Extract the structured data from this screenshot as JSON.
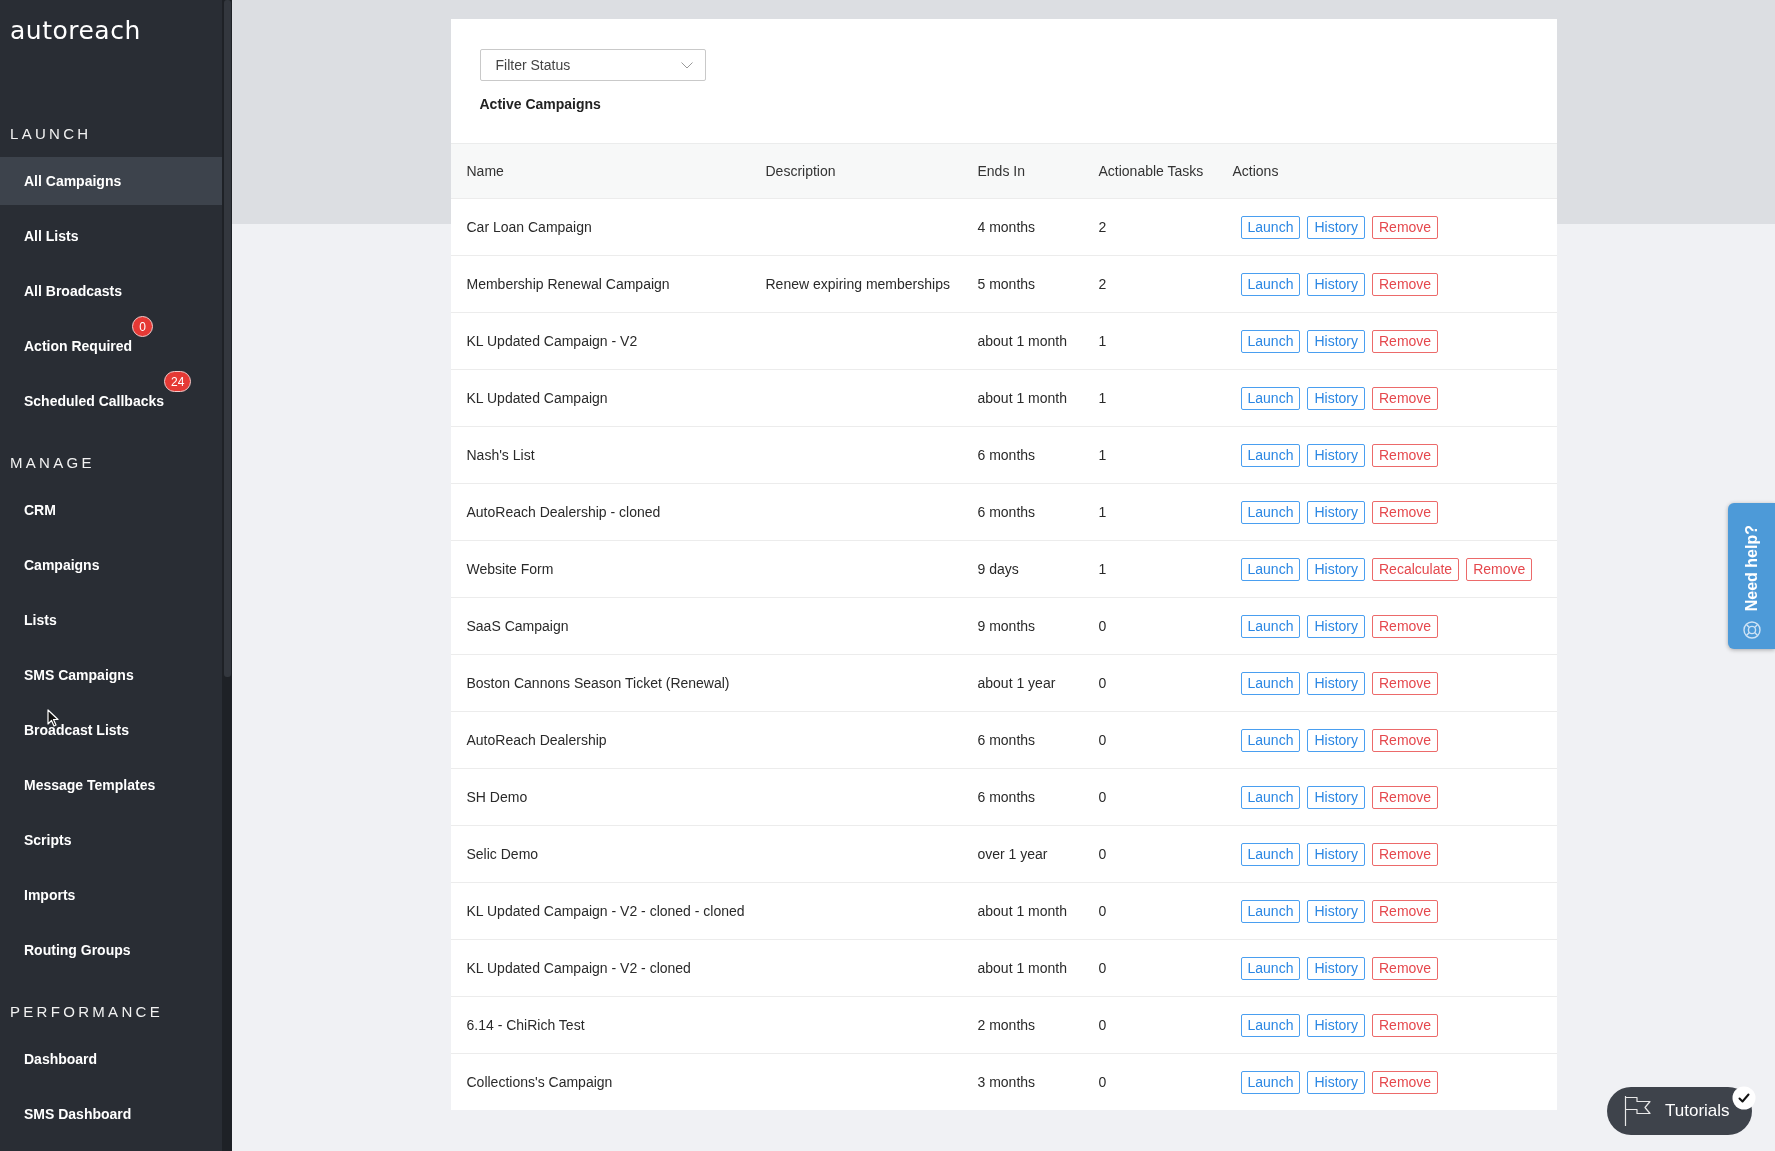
{
  "logo": {
    "text": "autoreach"
  },
  "sidebar": {
    "sections": [
      {
        "title": "LAUNCH",
        "items": [
          {
            "label": "All Campaigns",
            "selected": true
          },
          {
            "label": "All Lists",
            "selected": false
          },
          {
            "label": "All Broadcasts",
            "selected": false
          },
          {
            "label": "Action Required",
            "selected": false,
            "badge": "0"
          },
          {
            "label": "Scheduled Callbacks",
            "selected": false,
            "badge": "24"
          }
        ]
      },
      {
        "title": "MANAGE",
        "items": [
          {
            "label": "CRM",
            "selected": false
          },
          {
            "label": "Campaigns",
            "selected": false
          },
          {
            "label": "Lists",
            "selected": false
          },
          {
            "label": "SMS Campaigns",
            "selected": false
          },
          {
            "label": "Broadcast Lists",
            "selected": false
          },
          {
            "label": "Message Templates",
            "selected": false
          },
          {
            "label": "Scripts",
            "selected": false
          },
          {
            "label": "Imports",
            "selected": false
          },
          {
            "label": "Routing Groups",
            "selected": false
          }
        ]
      },
      {
        "title": "PERFORMANCE",
        "items": [
          {
            "label": "Dashboard",
            "selected": false
          },
          {
            "label": "SMS Dashboard",
            "selected": false
          }
        ]
      }
    ]
  },
  "filter": {
    "placeholder": "Filter Status"
  },
  "table": {
    "title": "Active Campaigns",
    "columns": [
      "Name",
      "Description",
      "Ends In",
      "Actionable Tasks",
      "Actions"
    ],
    "rows": [
      {
        "name": "Car Loan Campaign",
        "ends_in": "4 months",
        "actionable_tasks": "2",
        "actions": [
          {
            "label": "Launch",
            "kind": "primary"
          },
          {
            "label": "History",
            "kind": "primary"
          },
          {
            "label": "Remove",
            "kind": "danger"
          }
        ]
      },
      {
        "name": "Membership Renewal Campaign",
        "description": "Renew expiring memberships",
        "ends_in": "5 months",
        "actionable_tasks": "2",
        "actions": [
          {
            "label": "Launch",
            "kind": "primary"
          },
          {
            "label": "History",
            "kind": "primary"
          },
          {
            "label": "Remove",
            "kind": "danger"
          }
        ]
      },
      {
        "name": "KL Updated Campaign - V2",
        "ends_in": "about 1 month",
        "actionable_tasks": "1",
        "actions": [
          {
            "label": "Launch",
            "kind": "primary"
          },
          {
            "label": "History",
            "kind": "primary"
          },
          {
            "label": "Remove",
            "kind": "danger"
          }
        ]
      },
      {
        "name": "KL Updated Campaign",
        "ends_in": "about 1 month",
        "actionable_tasks": "1",
        "actions": [
          {
            "label": "Launch",
            "kind": "primary"
          },
          {
            "label": "History",
            "kind": "primary"
          },
          {
            "label": "Remove",
            "kind": "danger"
          }
        ]
      },
      {
        "name": "Nash's List",
        "ends_in": "6 months",
        "actionable_tasks": "1",
        "actions": [
          {
            "label": "Launch",
            "kind": "primary"
          },
          {
            "label": "History",
            "kind": "primary"
          },
          {
            "label": "Remove",
            "kind": "danger"
          }
        ]
      },
      {
        "name": "AutoReach Dealership - cloned",
        "ends_in": "6 months",
        "actionable_tasks": "1",
        "actions": [
          {
            "label": "Launch",
            "kind": "primary"
          },
          {
            "label": "History",
            "kind": "primary"
          },
          {
            "label": "Remove",
            "kind": "danger"
          }
        ]
      },
      {
        "name": "Website Form",
        "ends_in": "9 days",
        "actionable_tasks": "1",
        "actions": [
          {
            "label": "Launch",
            "kind": "primary"
          },
          {
            "label": "History",
            "kind": "primary"
          },
          {
            "label": "Recalculate",
            "kind": "danger"
          },
          {
            "label": "Remove",
            "kind": "danger"
          }
        ]
      },
      {
        "name": "SaaS Campaign",
        "ends_in": "9 months",
        "actionable_tasks": "0",
        "actions": [
          {
            "label": "Launch",
            "kind": "primary"
          },
          {
            "label": "History",
            "kind": "primary"
          },
          {
            "label": "Remove",
            "kind": "danger"
          }
        ]
      },
      {
        "name": "Boston Cannons Season Ticket (Renewal)",
        "ends_in": "about 1 year",
        "actionable_tasks": "0",
        "actions": [
          {
            "label": "Launch",
            "kind": "primary"
          },
          {
            "label": "History",
            "kind": "primary"
          },
          {
            "label": "Remove",
            "kind": "danger"
          }
        ]
      },
      {
        "name": "AutoReach Dealership",
        "ends_in": "6 months",
        "actionable_tasks": "0",
        "actions": [
          {
            "label": "Launch",
            "kind": "primary"
          },
          {
            "label": "History",
            "kind": "primary"
          },
          {
            "label": "Remove",
            "kind": "danger"
          }
        ]
      },
      {
        "name": "SH Demo",
        "ends_in": "6 months",
        "actionable_tasks": "0",
        "actions": [
          {
            "label": "Launch",
            "kind": "primary"
          },
          {
            "label": "History",
            "kind": "primary"
          },
          {
            "label": "Remove",
            "kind": "danger"
          }
        ]
      },
      {
        "name": "Selic Demo",
        "ends_in": "over 1 year",
        "actionable_tasks": "0",
        "actions": [
          {
            "label": "Launch",
            "kind": "primary"
          },
          {
            "label": "History",
            "kind": "primary"
          },
          {
            "label": "Remove",
            "kind": "danger"
          }
        ]
      },
      {
        "name": "KL Updated Campaign - V2 - cloned - cloned",
        "ends_in": "about 1 month",
        "actionable_tasks": "0",
        "actions": [
          {
            "label": "Launch",
            "kind": "primary"
          },
          {
            "label": "History",
            "kind": "primary"
          },
          {
            "label": "Remove",
            "kind": "danger"
          }
        ]
      },
      {
        "name": "KL Updated Campaign - V2 - cloned",
        "ends_in": "about 1 month",
        "actionable_tasks": "0",
        "actions": [
          {
            "label": "Launch",
            "kind": "primary"
          },
          {
            "label": "History",
            "kind": "primary"
          },
          {
            "label": "Remove",
            "kind": "danger"
          }
        ]
      },
      {
        "name": "6.14 - ChiRich Test",
        "ends_in": "2 months",
        "actionable_tasks": "0",
        "actions": [
          {
            "label": "Launch",
            "kind": "primary"
          },
          {
            "label": "History",
            "kind": "primary"
          },
          {
            "label": "Remove",
            "kind": "danger"
          }
        ]
      },
      {
        "name": "Collections's Campaign",
        "ends_in": "3 months",
        "actionable_tasks": "0",
        "actions": [
          {
            "label": "Launch",
            "kind": "primary"
          },
          {
            "label": "History",
            "kind": "primary"
          },
          {
            "label": "Remove",
            "kind": "danger"
          }
        ]
      }
    ]
  },
  "help_tab": {
    "label": "Need help?"
  },
  "tutorials": {
    "label": "Tutorials",
    "completed": true
  }
}
